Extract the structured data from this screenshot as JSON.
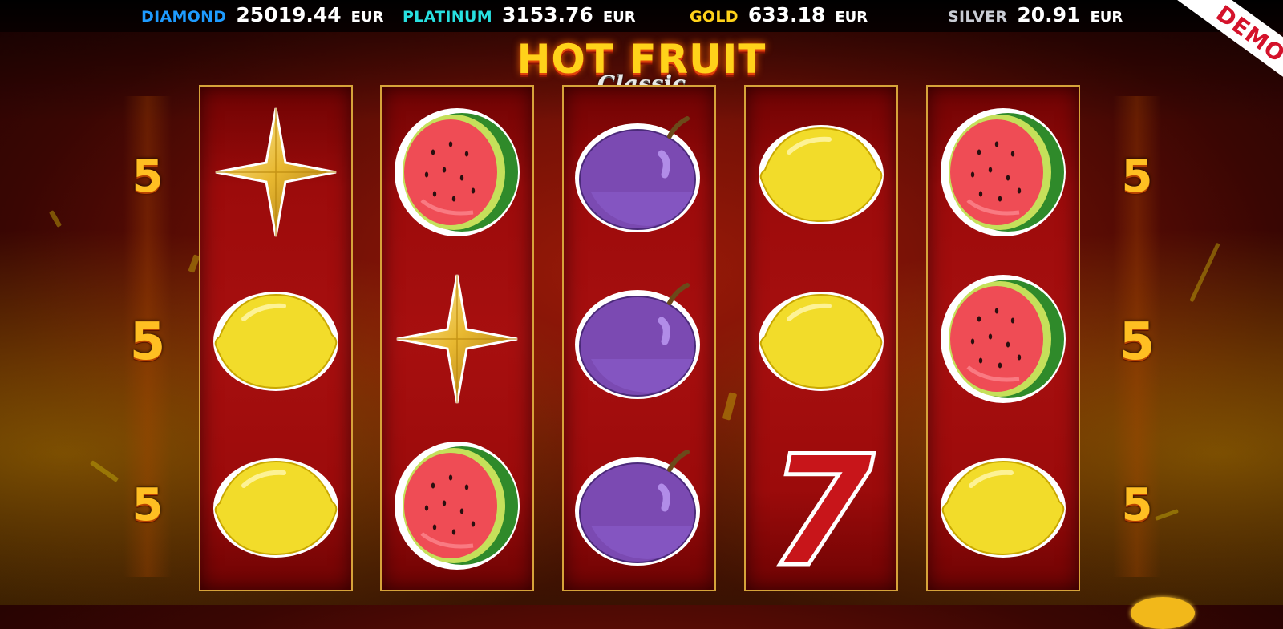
{
  "jackpots": [
    {
      "name": "DIAMOND",
      "value": "25019.44",
      "currency": "EUR",
      "color": "#1e9bff"
    },
    {
      "name": "PLATINUM",
      "value": "3153.76",
      "currency": "EUR",
      "color": "#28e0e0"
    },
    {
      "name": "GOLD",
      "value": "633.18",
      "currency": "EUR",
      "color": "#ffd21a"
    },
    {
      "name": "SILVER",
      "value": "20.91",
      "currency": "EUR",
      "color": "#c9ccd4"
    }
  ],
  "demo_label": "DEMO",
  "logo": {
    "title": "HOT FRUIT",
    "subtitle": "Classic"
  },
  "paylines": {
    "left": [
      "5",
      "5",
      "5"
    ],
    "right": [
      "5",
      "5",
      "5"
    ]
  },
  "reels": [
    [
      "star",
      "lemon",
      "lemon"
    ],
    [
      "watermelon",
      "star",
      "watermelon"
    ],
    [
      "plum",
      "plum",
      "plum"
    ],
    [
      "lemon",
      "lemon",
      "seven"
    ],
    [
      "watermelon",
      "watermelon",
      "lemon"
    ]
  ],
  "colors": {
    "reel_border": "#d6a33a",
    "reel_bg": "#a70f0f",
    "payline_number": "#ffbf22",
    "demo_text": "#d4122b"
  },
  "symbol_text": {
    "seven": "7"
  }
}
